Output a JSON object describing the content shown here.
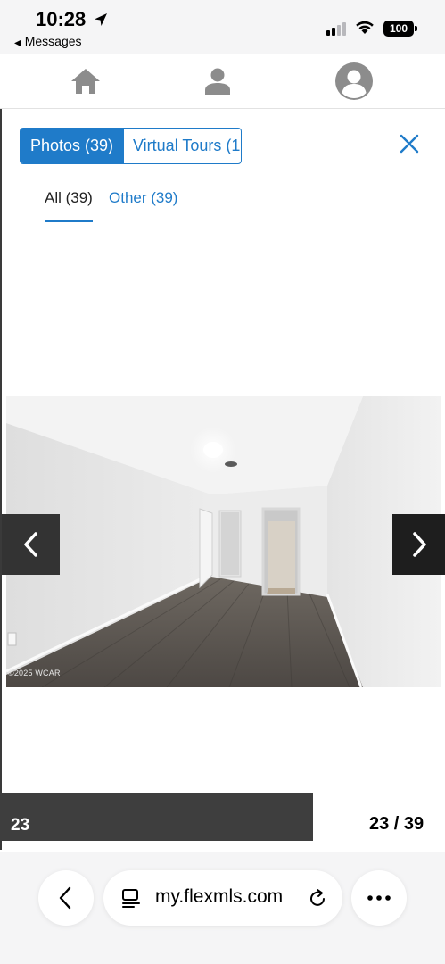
{
  "status_bar": {
    "time": "10:28",
    "back_app": "Messages",
    "battery": "100",
    "icons": [
      "location-arrow-icon",
      "signal-icon",
      "wifi-icon",
      "battery-icon"
    ]
  },
  "top_nav": {
    "icons": [
      "home-icon",
      "user-icon",
      "avatar-icon"
    ]
  },
  "media_tabs": [
    {
      "label": "Photos (39)",
      "active": true
    },
    {
      "label": "Virtual Tours (1",
      "active": false
    }
  ],
  "filters": [
    {
      "label": "All (39)",
      "active": true
    },
    {
      "label": "Other (39)",
      "active": false
    }
  ],
  "photo": {
    "watermark": "©2025 WCAR"
  },
  "thumbnail": {
    "number": "23"
  },
  "counter": "23 / 39",
  "browser": {
    "url": "my.flexmls.com"
  },
  "colors": {
    "accent": "#1f7bc9",
    "nav_button_dark": "#1e1e1e",
    "thumb_bar": "#3e3e3e"
  }
}
